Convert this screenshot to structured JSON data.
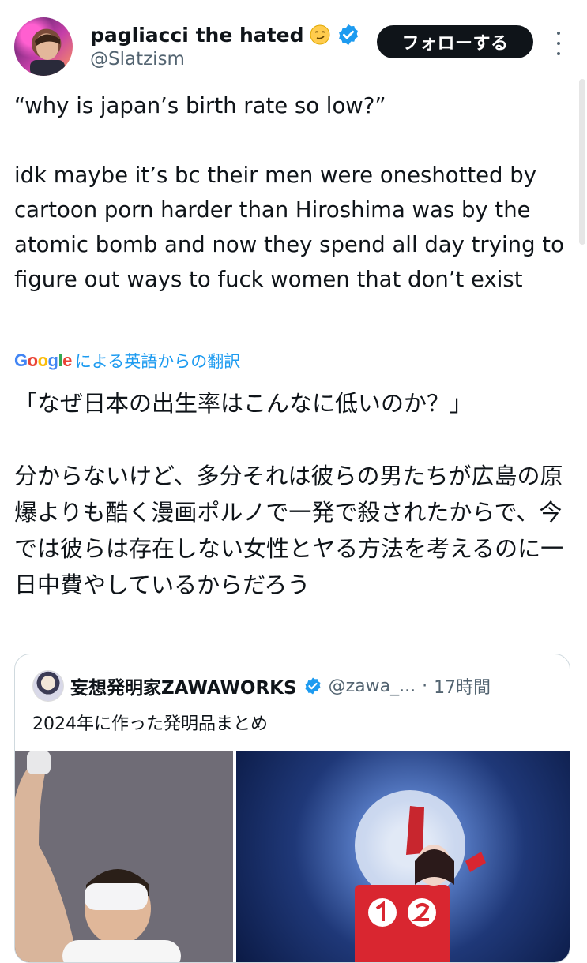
{
  "user": {
    "display_name": "pagliacci the hated",
    "handle": "@Slatzism",
    "emoji": "smirking-face",
    "verified": true
  },
  "follow_button": {
    "label": "フォローする"
  },
  "tweet": {
    "text": "“why is japan’s birth rate so low?”\n\nidk maybe it’s bc their men were oneshotted by cartoon porn harder than Hiroshima was by the atomic bomb and now they spend all day trying to figure out ways to fuck women that don’t exist"
  },
  "translation": {
    "provider": "Google",
    "label": "による英語からの翻訳",
    "text": "「なぜ日本の出生率はこんなに低いのか？」\n\n分からないけど、多分それは彼らの男たちが広島の原爆よりも酷く漫画ポルノで一発で殺されたからで、今では彼らは存在しない女性とヤる方法を考えるのに一日中費やしているからだろう"
  },
  "quoted_tweet": {
    "display_name": "妄想発明家ZAWAWORKS",
    "handle": "@zawa_...",
    "separator": "·",
    "time": "17時間",
    "text": "2024年に作った発明品まとめ",
    "verified": true
  },
  "colors": {
    "accent": "#1d9bf0",
    "text": "#0f1419",
    "secondary": "#536471",
    "button_bg": "#0f1419"
  }
}
